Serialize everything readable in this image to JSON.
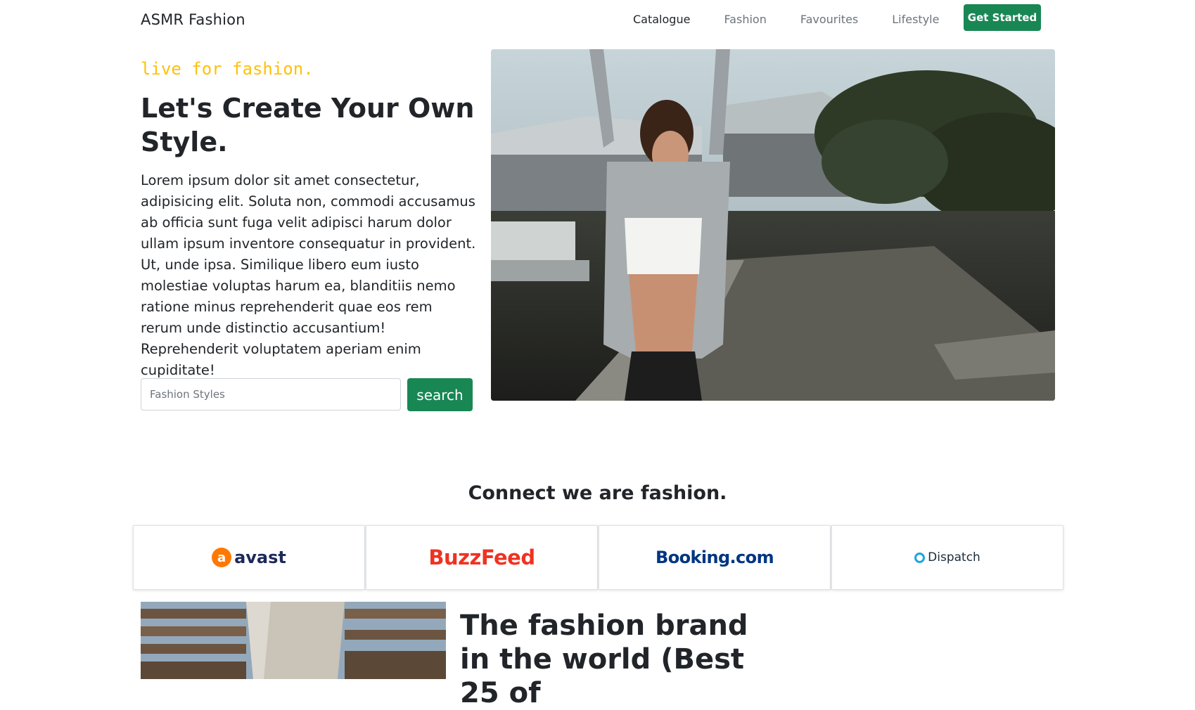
{
  "navbar": {
    "brand": "ASMR Fashion",
    "links": [
      {
        "label": "Catalogue",
        "active": true
      },
      {
        "label": "Fashion",
        "active": false
      },
      {
        "label": "Favourites",
        "active": false
      },
      {
        "label": "Lifestyle",
        "active": false
      }
    ],
    "cta_label": "Get Started"
  },
  "hero": {
    "tagline": "live for fashion.",
    "headline": "Let's Create Your Own Style.",
    "lead": "Lorem ipsum dolor sit amet consectetur, adipisicing elit. Soluta non, commodi accusamus ab officia sunt fuga velit adipisci harum dolor ullam ipsum inventore consequatur in provident. Ut, unde ipsa. Similique libero eum iusto molestiae voluptas harum ea, blanditiis nemo ratione minus reprehenderit quae eos rem rerum unde distinctio accusantium! Reprehenderit voluptatem aperiam enim cupiditate!",
    "search": {
      "placeholder": "Fashion Styles",
      "value": "",
      "button_label": "search"
    }
  },
  "partners": {
    "title": "Connect we are fashion.",
    "logos": [
      {
        "name": "avast",
        "mark": "a",
        "color": "#ff7800"
      },
      {
        "name": "BuzzFeed",
        "color": "#ee3322"
      },
      {
        "name": "Booking.com",
        "color": "#003580"
      },
      {
        "name": "Dispatch",
        "color": "#1ba5e0"
      }
    ]
  },
  "feature": {
    "heading": "The fashion brand in the world (Best 25 of"
  },
  "colors": {
    "accent": "#198754",
    "tagline": "#ffc107",
    "text": "#212529",
    "muted": "#6c757d"
  }
}
